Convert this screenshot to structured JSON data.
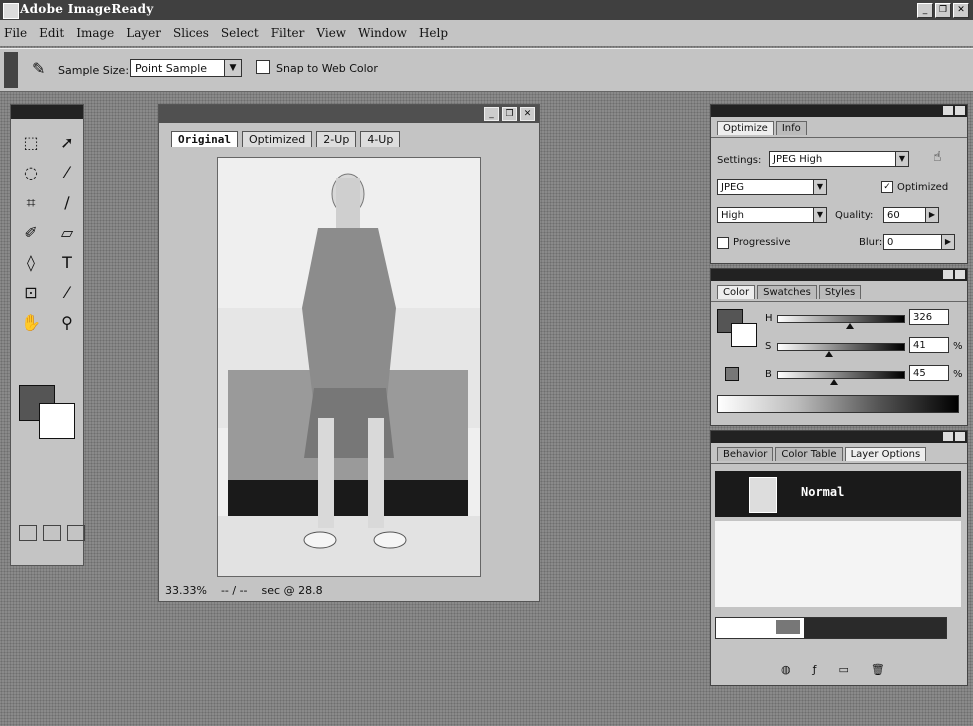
{
  "app": {
    "title": "Adobe ImageReady"
  },
  "window_buttons": [
    "_",
    "❐",
    "✕"
  ],
  "menu": [
    "File",
    "Edit",
    "Image",
    "Layer",
    "Slices",
    "Select",
    "Filter",
    "View",
    "Window",
    "Help"
  ],
  "options": {
    "sample_size_label": "Sample Size:",
    "sample_size_value": "Point Sample",
    "snap_label": "Snap to Web Color"
  },
  "document": {
    "tabs": [
      "Original",
      "Optimized",
      "2-Up",
      "4-Up"
    ],
    "zoom": "33.33%",
    "status_a": "-- / --",
    "status_b": "sec @ 28.8"
  },
  "optimize_panel": {
    "tabs": [
      "Optimize",
      "Info"
    ],
    "settings_label": "Settings:",
    "settings_value": "JPEG High",
    "format_value": "JPEG",
    "optimized_label": "Optimized",
    "quality_preset": "High",
    "quality_label": "Quality:",
    "quality_value": "60",
    "progressive_label": "Progressive",
    "blur_label": "Blur:",
    "blur_value": "0"
  },
  "color_panel": {
    "tabs": [
      "Color",
      "Swatches",
      "Styles"
    ],
    "h_label": "H",
    "s_label": "S",
    "b_label": "B",
    "h_value": "326",
    "s_value": "41",
    "b_value": "45",
    "pct": "%",
    "h_level": 0.58,
    "s_level": 0.41,
    "b_level": 0.45
  },
  "layers_panel": {
    "tabs": [
      "Behavior",
      "Color Table",
      "Layer Options"
    ],
    "blend_mode": "Normal"
  },
  "colors": {
    "fg": "#555555",
    "bg": "#ffffff"
  }
}
